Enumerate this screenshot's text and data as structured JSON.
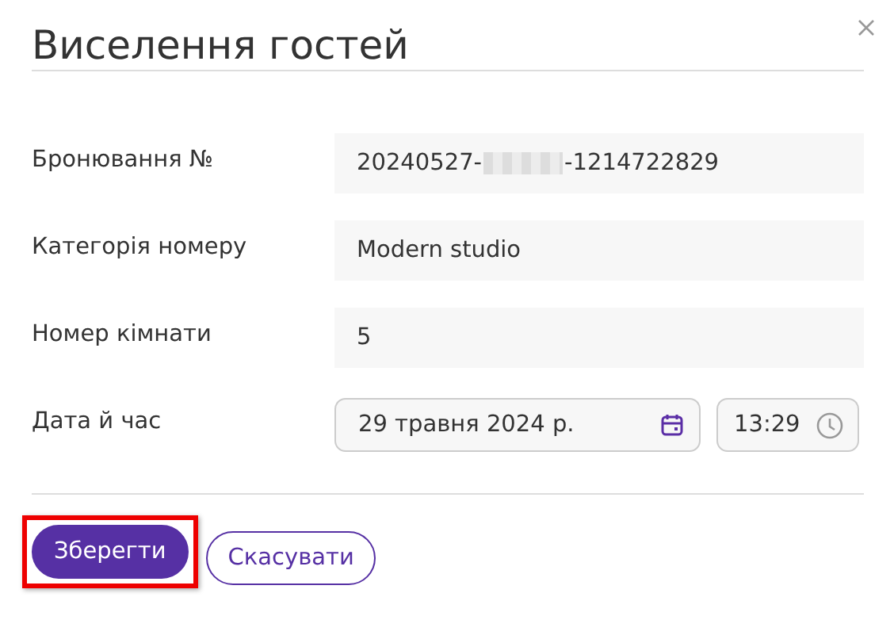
{
  "dialog": {
    "title": "Виселення гостей"
  },
  "fields": [
    {
      "kind": "text",
      "label": "Бронювання №",
      "value": "20240527-",
      "redacted": true,
      "value_end": "-1214722829"
    },
    {
      "kind": "text",
      "label": "Категорія номеру",
      "value": "Modern studio"
    },
    {
      "kind": "text",
      "label": "Номер кімнати",
      "value": "5"
    },
    {
      "kind": "datetime",
      "label": "Дата й час",
      "date": "29 травня 2024 р.",
      "time": "13:29"
    }
  ],
  "buttons": [
    {
      "kind": "primary",
      "label": "Зберегти",
      "highlighted": true
    },
    {
      "kind": "secondary",
      "label": "Скасувати",
      "highlighted": false
    }
  ]
}
